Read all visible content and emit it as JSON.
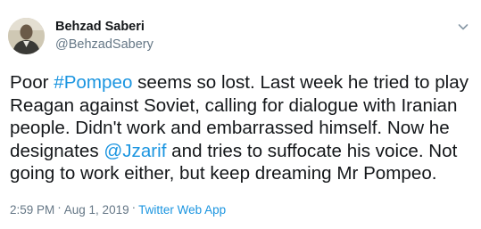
{
  "author": {
    "display_name": "Behzad Saberi",
    "handle": "@BehzadSabery"
  },
  "tweet": {
    "segments": [
      {
        "text": "Poor ",
        "type": "text"
      },
      {
        "text": "#Pompeo",
        "type": "hashtag"
      },
      {
        "text": " seems so lost. Last week he tried to play\nReagan against Soviet, calling for dialogue with Iranian\npeople. Didn't work and embarrassed himself. Now he\ndesignates ",
        "type": "text"
      },
      {
        "text": "@Jzarif",
        "type": "mention"
      },
      {
        "text": " and tries to suffocate his voice. Not\ngoing to work either, but keep dreaming Mr Pompeo.",
        "type": "text"
      }
    ]
  },
  "meta": {
    "time": "2:59 PM",
    "separator": "·",
    "date": "Aug 1, 2019",
    "source": "Twitter Web App"
  },
  "icons": {
    "more": "chevron-down-icon"
  },
  "colors": {
    "text": "#14171a",
    "secondary": "#657786",
    "link": "#1b95e0"
  }
}
